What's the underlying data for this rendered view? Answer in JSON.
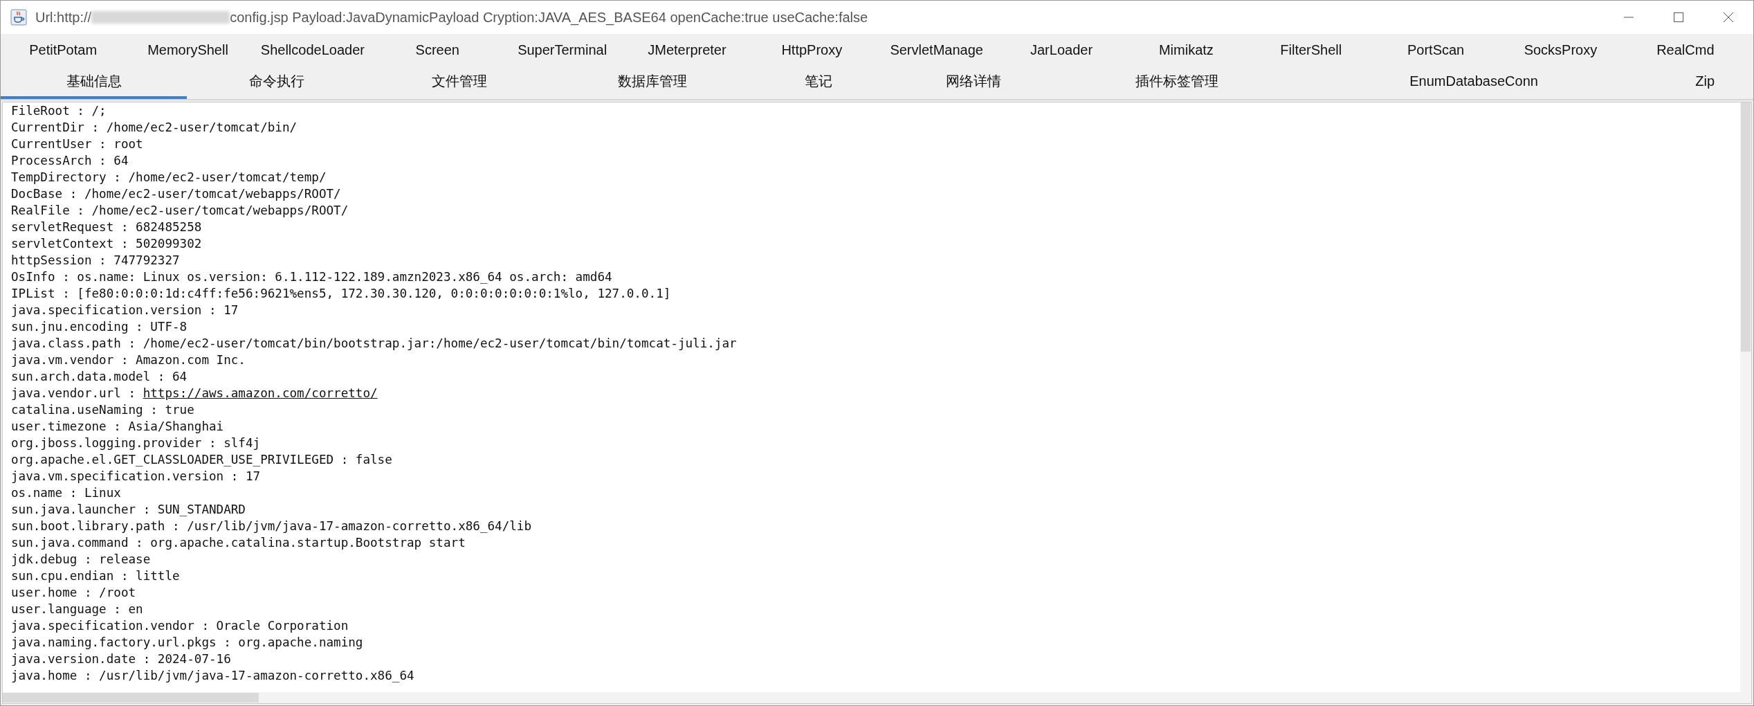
{
  "window": {
    "title_start": "Url:http://",
    "title_redacted": true,
    "title_end": "config.jsp Payload:JavaDynamicPayload Cryption:JAVA_AES_BASE64 openCache:true useCache:false"
  },
  "plugin_tabs": [
    {
      "label": "PetitPotam"
    },
    {
      "label": "MemoryShell"
    },
    {
      "label": "ShellcodeLoader"
    },
    {
      "label": "Screen"
    },
    {
      "label": "SuperTerminal"
    },
    {
      "label": "JMeterpreter"
    },
    {
      "label": "HttpProxy"
    },
    {
      "label": "ServletManage"
    },
    {
      "label": "JarLoader"
    },
    {
      "label": "Mimikatz"
    },
    {
      "label": "FilterShell"
    },
    {
      "label": "PortScan"
    },
    {
      "label": "SocksProxy"
    },
    {
      "label": "RealCmd"
    }
  ],
  "tabs": [
    {
      "label": "基础信息",
      "selected": true
    },
    {
      "label": "命令执行",
      "selected": false
    },
    {
      "label": "文件管理",
      "selected": false
    },
    {
      "label": "数据库管理",
      "selected": false
    },
    {
      "label": "笔记",
      "selected": false
    },
    {
      "label": "网络详情",
      "selected": false
    },
    {
      "label": "插件标签管理",
      "selected": false
    },
    {
      "label": "EnumDatabaseConn",
      "selected": false
    },
    {
      "label": "Zip",
      "selected": false
    }
  ],
  "info_lines": [
    {
      "kind": "plain",
      "text": "FileRoot : /;"
    },
    {
      "kind": "plain",
      "text": "CurrentDir : /home/ec2-user/tomcat/bin/"
    },
    {
      "kind": "plain",
      "text": "CurrentUser : root"
    },
    {
      "kind": "plain",
      "text": "ProcessArch : 64"
    },
    {
      "kind": "plain",
      "text": "TempDirectory : /home/ec2-user/tomcat/temp/"
    },
    {
      "kind": "plain",
      "text": "DocBase : /home/ec2-user/tomcat/webapps/ROOT/"
    },
    {
      "kind": "plain",
      "text": "RealFile : /home/ec2-user/tomcat/webapps/ROOT/"
    },
    {
      "kind": "plain",
      "text": "servletRequest : 682485258"
    },
    {
      "kind": "plain",
      "text": "servletContext : 502099302"
    },
    {
      "kind": "plain",
      "text": "httpSession : 747792327"
    },
    {
      "kind": "plain",
      "text": "OsInfo : os.name: Linux os.version: 6.1.112-122.189.amzn2023.x86_64 os.arch: amd64"
    },
    {
      "kind": "plain",
      "text": "IPList : [fe80:0:0:0:1d:c4ff:fe56:9621%ens5, 172.30.30.120, 0:0:0:0:0:0:0:1%lo, 127.0.0.1]"
    },
    {
      "kind": "plain",
      "text": "java.specification.version : 17"
    },
    {
      "kind": "plain",
      "text": "sun.jnu.encoding : UTF-8"
    },
    {
      "kind": "plain",
      "text": "java.class.path : /home/ec2-user/tomcat/bin/bootstrap.jar:/home/ec2-user/tomcat/bin/tomcat-juli.jar"
    },
    {
      "kind": "plain",
      "text": "java.vm.vendor : Amazon.com Inc."
    },
    {
      "kind": "plain",
      "text": "sun.arch.data.model : 64"
    },
    {
      "kind": "link",
      "text": "java.vendor.url :",
      "url": "https://aws.amazon.com/corretto/"
    },
    {
      "kind": "plain",
      "text": "catalina.useNaming : true"
    },
    {
      "kind": "plain",
      "text": "user.timezone : Asia/Shanghai"
    },
    {
      "kind": "plain",
      "text": "org.jboss.logging.provider : slf4j"
    },
    {
      "kind": "plain",
      "text": "org.apache.el.GET_CLASSLOADER_USE_PRIVILEGED : false"
    },
    {
      "kind": "plain",
      "text": "java.vm.specification.version : 17"
    },
    {
      "kind": "plain",
      "text": "os.name : Linux"
    },
    {
      "kind": "plain",
      "text": "sun.java.launcher : SUN_STANDARD"
    },
    {
      "kind": "plain",
      "text": "sun.boot.library.path : /usr/lib/jvm/java-17-amazon-corretto.x86_64/lib"
    },
    {
      "kind": "plain",
      "text": "sun.java.command : org.apache.catalina.startup.Bootstrap start"
    },
    {
      "kind": "plain",
      "text": "jdk.debug : release"
    },
    {
      "kind": "plain",
      "text": "sun.cpu.endian : little"
    },
    {
      "kind": "plain",
      "text": "user.home : /root"
    },
    {
      "kind": "plain",
      "text": "user.language : en"
    },
    {
      "kind": "plain",
      "text": "java.specification.vendor : Oracle Corporation"
    },
    {
      "kind": "plain",
      "text": "java.naming.factory.url.pkgs : org.apache.naming"
    },
    {
      "kind": "plain",
      "text": "java.version.date : 2024-07-16"
    },
    {
      "kind": "plain",
      "text": "java.home : /usr/lib/jvm/java-17-amazon-corretto.x86_64"
    }
  ]
}
